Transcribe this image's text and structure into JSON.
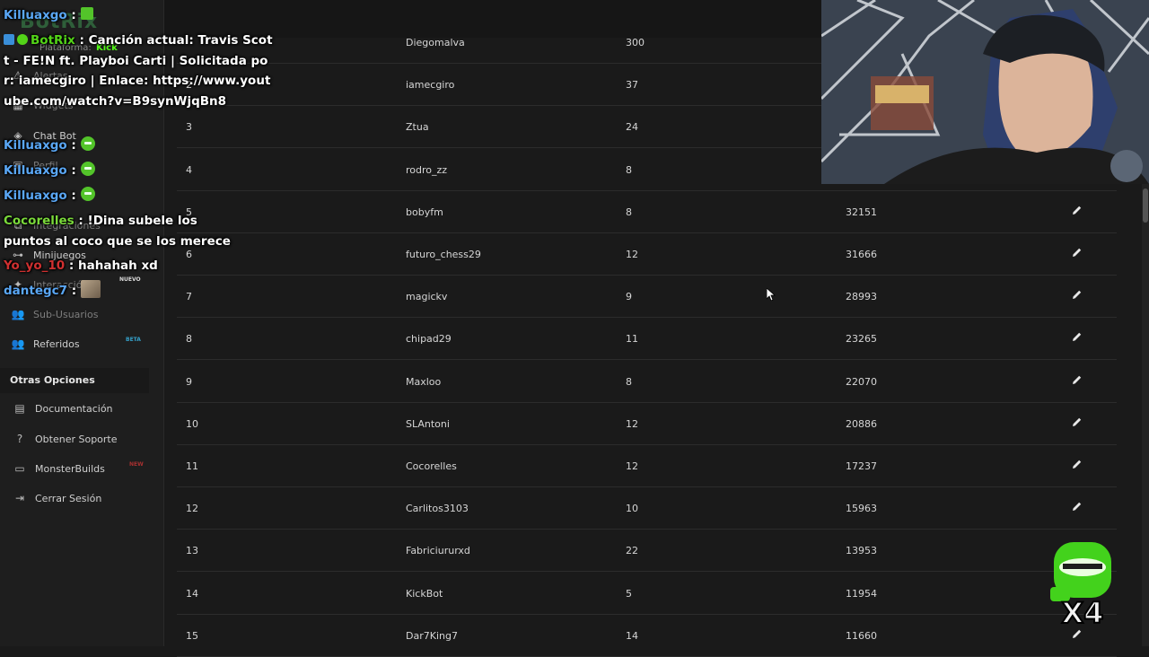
{
  "sidebar": {
    "brand": "BotRix",
    "platform_label": "Plataforma:",
    "platform_value": "Kick",
    "items": [
      {
        "label": "Alertas",
        "icon": "alert-icon",
        "dim": true
      },
      {
        "label": "Widgets",
        "icon": "widget-icon",
        "dim": true
      },
      {
        "label": "Chat Bot",
        "icon": "robot-icon",
        "dim": false
      },
      {
        "label": "Perfil",
        "icon": "profile-icon",
        "dim": true
      },
      {
        "label": "Integraciones",
        "icon": "integrations-icon",
        "dim": true
      },
      {
        "label": "Minijuegos",
        "icon": "gamepad-icon",
        "dim": false
      },
      {
        "label": "Interacción",
        "icon": "interaction-icon",
        "dim": true,
        "badge": "NUEVO"
      },
      {
        "label": "Sub-Usuarios",
        "icon": "users-icon",
        "dim": true
      },
      {
        "label": "Referidos",
        "icon": "referral-icon",
        "dim": false,
        "badge": "BETA"
      }
    ],
    "section_title": "Otras Opciones",
    "other_items": [
      {
        "label": "Documentación",
        "icon": "book-icon"
      },
      {
        "label": "Obtener Soporte",
        "icon": "help-icon"
      },
      {
        "label": "MonsterBuilds",
        "icon": "monitor-icon",
        "badge": "NEW"
      },
      {
        "label": "Cerrar Sesión",
        "icon": "logout-icon"
      }
    ]
  },
  "table": {
    "rows": [
      {
        "rank": "",
        "name": "Diegomalva",
        "level": "300",
        "points": ""
      },
      {
        "rank": "2",
        "name": "iamecgiro",
        "level": "37",
        "points": ""
      },
      {
        "rank": "3",
        "name": "Ztua",
        "level": "24",
        "points": ""
      },
      {
        "rank": "4",
        "name": "rodro_zz",
        "level": "8",
        "points": ""
      },
      {
        "rank": "5",
        "name": "bobyfm",
        "level": "8",
        "points": "32151"
      },
      {
        "rank": "6",
        "name": "futuro_chess29",
        "level": "12",
        "points": "31666"
      },
      {
        "rank": "7",
        "name": "magickv",
        "level": "9",
        "points": "28993"
      },
      {
        "rank": "8",
        "name": "chipad29",
        "level": "11",
        "points": "23265"
      },
      {
        "rank": "9",
        "name": "Maxloo",
        "level": "8",
        "points": "22070"
      },
      {
        "rank": "10",
        "name": "SLAntoni",
        "level": "12",
        "points": "20886"
      },
      {
        "rank": "11",
        "name": "Cocorelles",
        "level": "12",
        "points": "17237"
      },
      {
        "rank": "12",
        "name": "Carlitos3103",
        "level": "10",
        "points": "15963"
      },
      {
        "rank": "13",
        "name": "Fabriciururxd",
        "level": "22",
        "points": "13953"
      },
      {
        "rank": "14",
        "name": "KickBot",
        "level": "5",
        "points": "11954"
      },
      {
        "rank": "15",
        "name": "Dar7King7",
        "level": "14",
        "points": "11660"
      }
    ]
  },
  "chat": [
    {
      "user": "Killuaxgo",
      "sep": " : ",
      "text": ""
    },
    {
      "user": "BotRix",
      "sep": " : ",
      "text": "Canción actual: Travis Scott - FE!N ft. Playboi Carti | Solicitada por: iamecgiro | Enlace: https://www.youtube.com/watch?v=B9synWjqBn8"
    },
    {
      "user": "Killuaxgo",
      "sep": " : ",
      "text": ""
    },
    {
      "user": "Killuaxgo",
      "sep": " : ",
      "text": ""
    },
    {
      "user": "Killuaxgo",
      "sep": " : ",
      "text": ""
    },
    {
      "user": "Cocorelles",
      "sep": " : ",
      "text": "!Dina subele los puntos al coco que se los merece"
    },
    {
      "user": "Yo_yo_10",
      "sep": " : ",
      "text": "hahahah xd"
    },
    {
      "user": "dantegc7",
      "sep": " : ",
      "text": ""
    }
  ],
  "overlay": {
    "multiplier": "X4"
  },
  "colors": {
    "kick_green": "#53fc18",
    "beta_blue": "#35a0c9",
    "bg": "#1a1a1a"
  }
}
